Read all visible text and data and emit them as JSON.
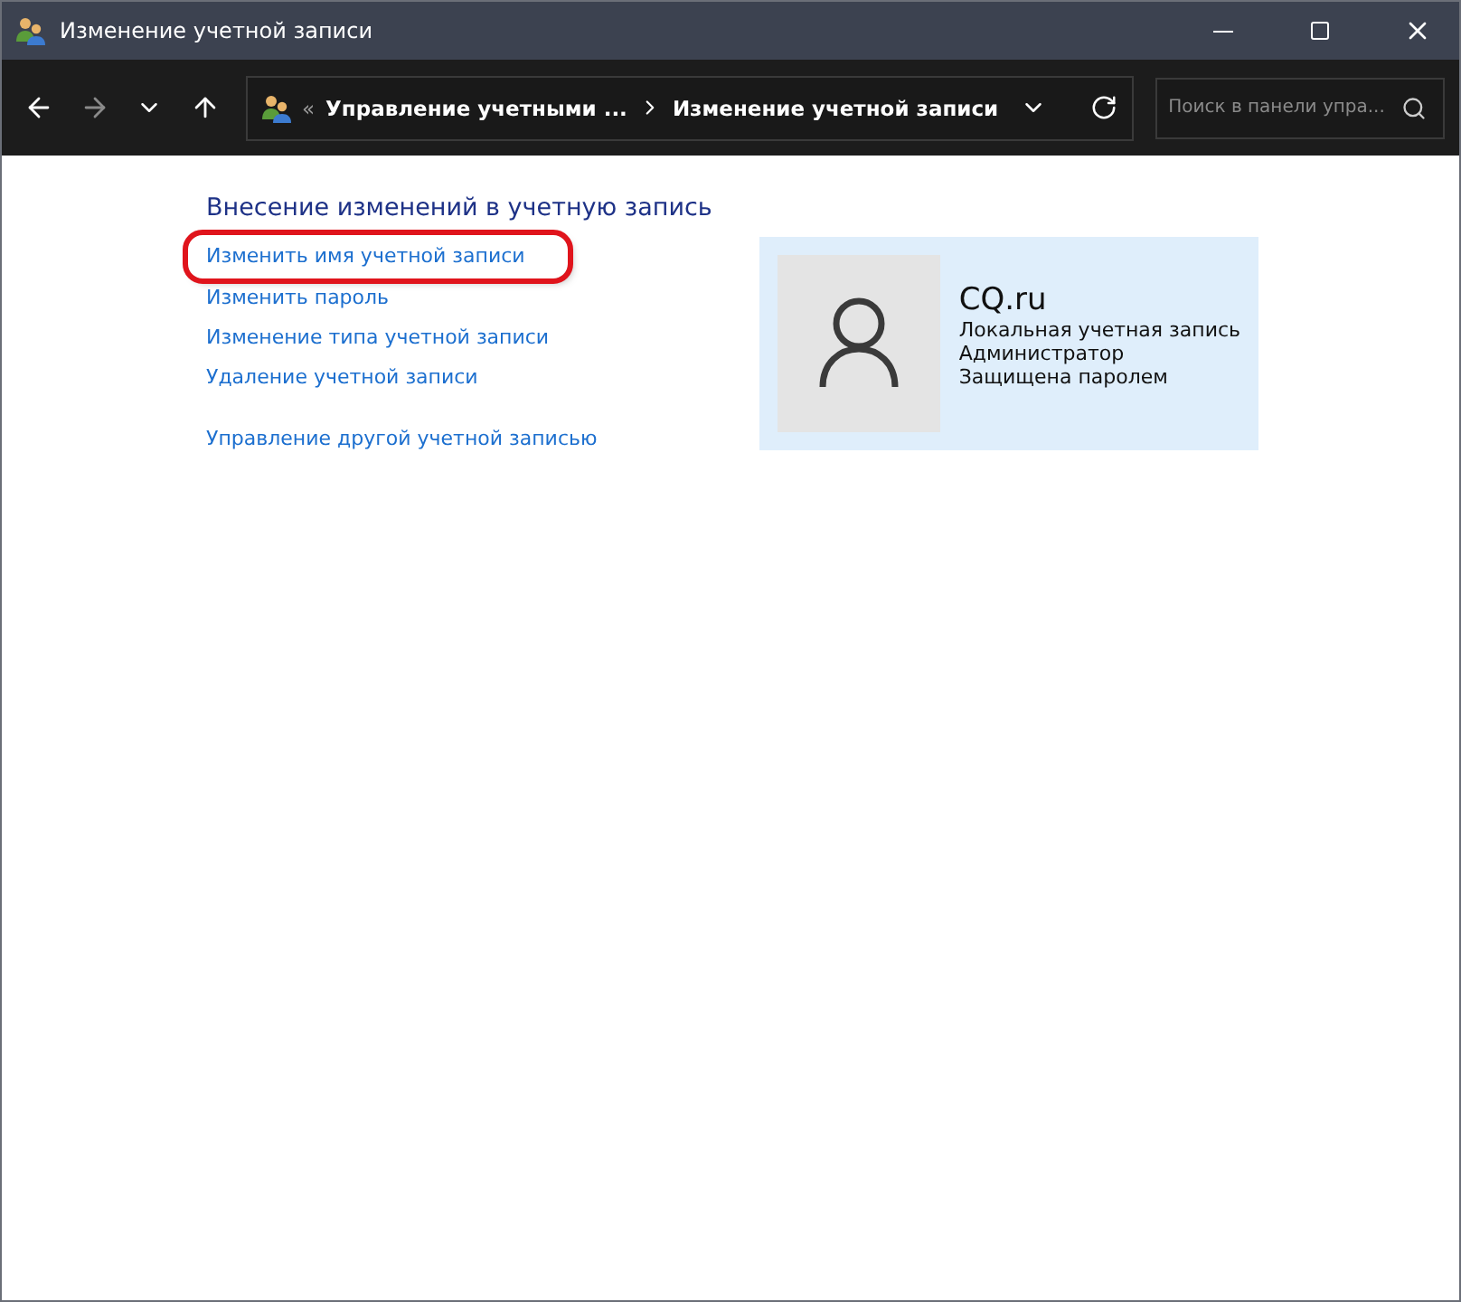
{
  "window": {
    "title": "Изменение учетной записи"
  },
  "address_bar": {
    "overflow": "«",
    "crumbs": [
      "Управление учетными ...",
      "Изменение учетной записи"
    ]
  },
  "search": {
    "placeholder": "Поиск в панели упра..."
  },
  "heading": "Внесение изменений в учетную запись",
  "link_groups": [
    [
      {
        "label": "Изменить имя учетной записи",
        "highlighted": true
      },
      {
        "label": "Изменить пароль",
        "highlighted": false
      },
      {
        "label": "Изменение типа учетной записи",
        "highlighted": false
      },
      {
        "label": "Удаление учетной записи",
        "highlighted": false
      }
    ],
    [
      {
        "label": "Управление другой учетной записью",
        "highlighted": false
      }
    ]
  ],
  "account": {
    "name": "CQ.ru",
    "details": [
      "Локальная учетная запись",
      "Администратор",
      "Защищена паролем"
    ]
  }
}
